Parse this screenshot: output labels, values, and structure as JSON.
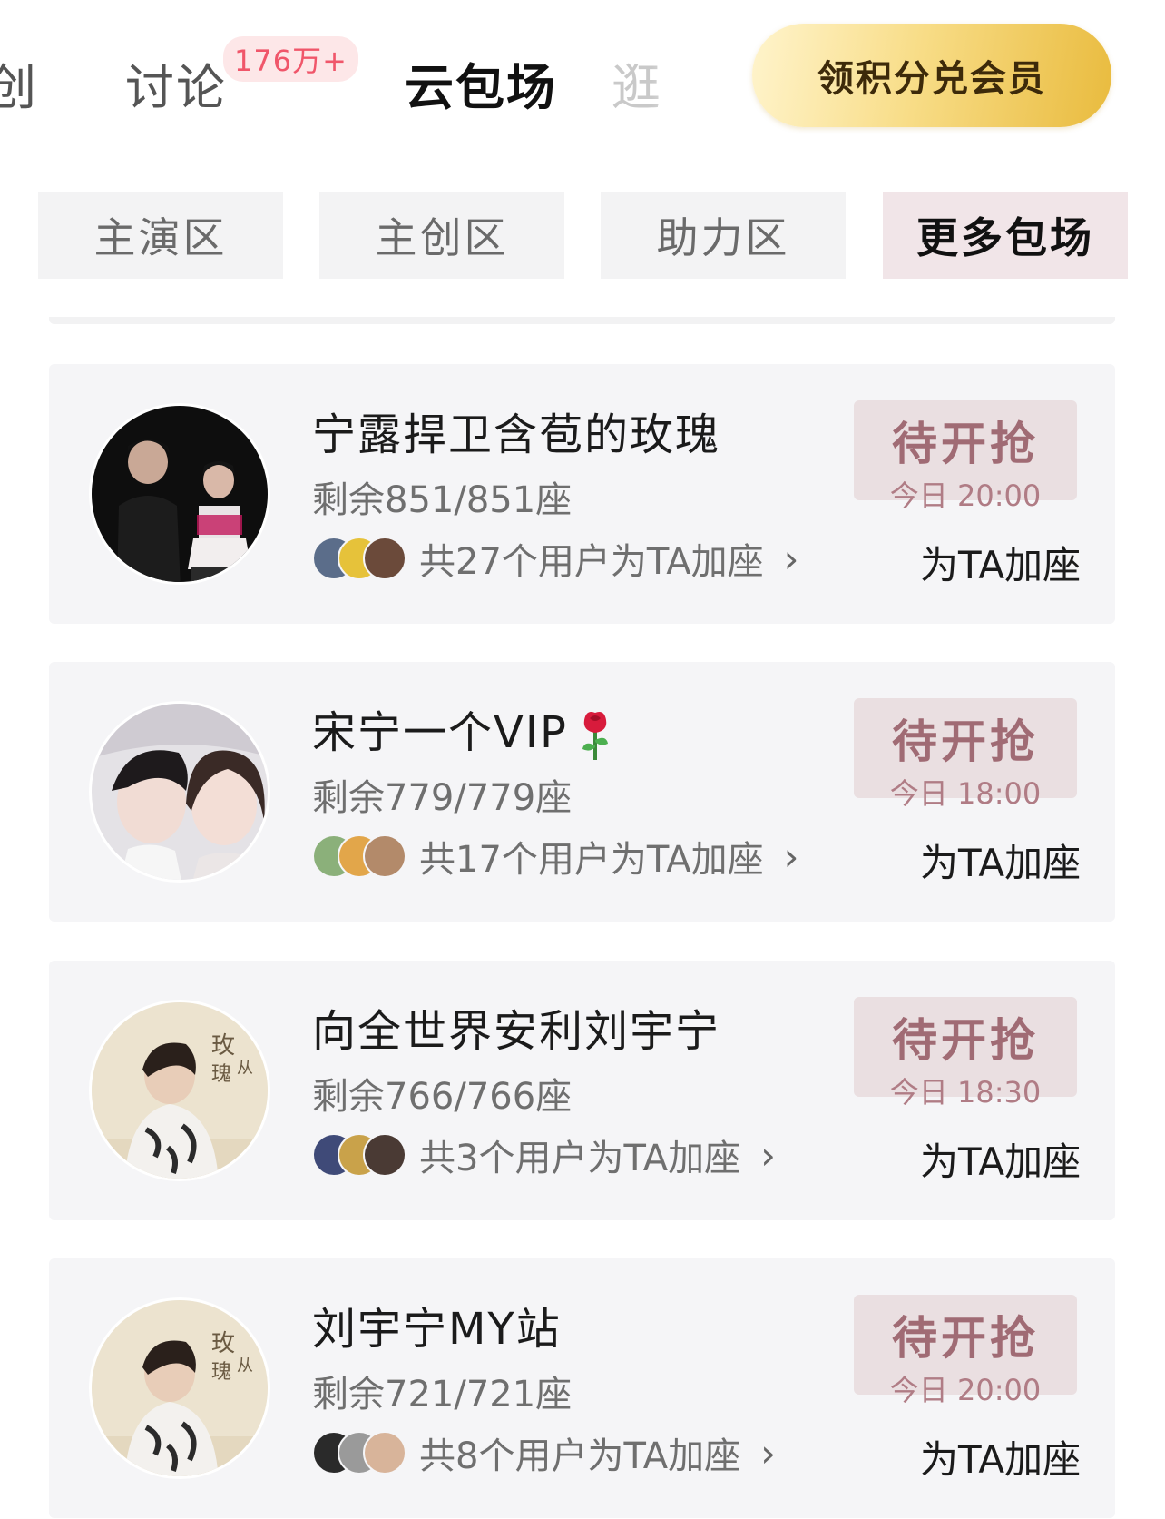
{
  "top_tabs": {
    "creative": "创",
    "discuss": "讨论",
    "discuss_badge": "176万+",
    "active": "云包场",
    "browse": "逛",
    "member_button": "领积分兑会员"
  },
  "categories": [
    "主演区",
    "主创区",
    "助力区",
    "更多包场"
  ],
  "cards": [
    {
      "title": "宁露捍卫含苞的玫瑰",
      "seats": "剩余851/851座",
      "supporters": "共27个用户为TA加座",
      "status": "待开抢",
      "time": "今日 20:00",
      "action": "为TA加座"
    },
    {
      "title": "宋宁一个VIP",
      "title_emoji": "rose-icon",
      "seats": "剩余779/779座",
      "supporters": "共17个用户为TA加座",
      "status": "待开抢",
      "time": "今日 18:00",
      "action": "为TA加座"
    },
    {
      "title": "向全世界安利刘宇宁",
      "seats": "剩余766/766座",
      "supporters": "共3个用户为TA加座",
      "status": "待开抢",
      "time": "今日 18:30",
      "action": "为TA加座"
    },
    {
      "title": "刘宇宁MY站",
      "seats": "剩余721/721座",
      "supporters": "共8个用户为TA加座",
      "status": "待开抢",
      "time": "今日 20:00",
      "action": "为TA加座"
    }
  ],
  "colors": {
    "accent_badge": "#f0566a",
    "status_bg": "#eadfe1",
    "status_text": "#a06b74",
    "active_category_bg": "#f1e5e8",
    "member_gold": "#e9bb3e"
  },
  "icons": {
    "chevron": "chevron-right-icon"
  }
}
